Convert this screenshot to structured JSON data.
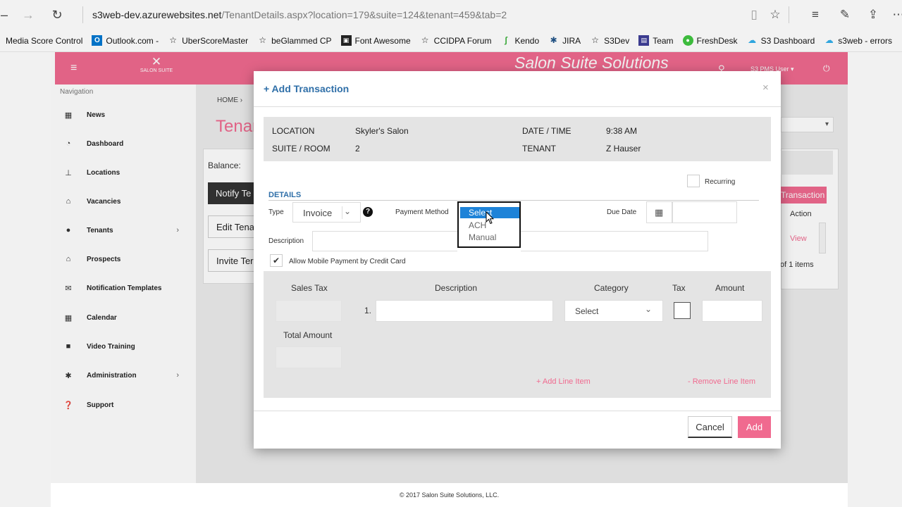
{
  "browser": {
    "url_host": "s3web-dev.azurewebsites.net",
    "url_path": "/TenantDetails.aspx?location=179&suite=124&tenant=459&tab=2",
    "favorites": [
      {
        "label": "Media Score Control",
        "icon": ""
      },
      {
        "label": "Outlook.com -",
        "icon": "outlook-icon"
      },
      {
        "label": "UberScoreMaster",
        "icon": "star-icon"
      },
      {
        "label": "beGlammed CP",
        "icon": "star-icon"
      },
      {
        "label": "Font Awesome",
        "icon": "flag-icon"
      },
      {
        "label": "CCIDPA Forum",
        "icon": "star-icon"
      },
      {
        "label": "Kendo",
        "icon": "kendo-icon"
      },
      {
        "label": "JIRA",
        "icon": "jira-icon"
      },
      {
        "label": "S3Dev",
        "icon": "star-icon"
      },
      {
        "label": "Team",
        "icon": "team-icon"
      },
      {
        "label": "FreshDesk",
        "icon": "freshdesk-icon"
      },
      {
        "label": "S3 Dashboard",
        "icon": "cloud-icon"
      },
      {
        "label": "s3web - errors",
        "icon": "cloud-icon"
      }
    ]
  },
  "app": {
    "brand_title": "Salon Suite Solutions",
    "logo_text": "SALON SUITE",
    "user_menu": "S3 PMS User",
    "nav_label": "Navigation",
    "nav_items": [
      {
        "label": "News",
        "icon": "newspaper-icon"
      },
      {
        "label": "Dashboard",
        "icon": "dashboard-icon"
      },
      {
        "label": "Locations",
        "icon": "pin-icon"
      },
      {
        "label": "Vacancies",
        "icon": "lock-icon"
      },
      {
        "label": "Tenants",
        "icon": "user-icon",
        "has_children": true
      },
      {
        "label": "Prospects",
        "icon": "lock-icon"
      },
      {
        "label": "Notification Templates",
        "icon": "envelope-icon"
      },
      {
        "label": "Calendar",
        "icon": "calendar-icon"
      },
      {
        "label": "Video Training",
        "icon": "video-icon"
      },
      {
        "label": "Administration",
        "icon": "gear-icon",
        "has_children": true
      },
      {
        "label": "Support",
        "icon": "question-icon"
      }
    ],
    "breadcrumb_home": "HOME",
    "page_title_partial": "Tenan",
    "balance_label": "Balance:",
    "bg_buttons": [
      "Notify Te",
      "Edit Tena",
      "Invite Ter"
    ],
    "bg_add_transaction": "Transaction",
    "bg_action_header": "Action",
    "bg_view_link": "View",
    "bg_items_text": "of 1 items",
    "footer": "© 2017 Salon Suite Solutions, LLC."
  },
  "modal": {
    "title": "+ Add Transaction",
    "info": {
      "location_label": "LOCATION",
      "location_value": "Skyler's Salon",
      "suite_label": "SUITE / ROOM",
      "suite_value": "2",
      "datetime_label": "DATE / TIME",
      "datetime_value": "9:38 AM",
      "tenant_label": "TENANT",
      "tenant_value": "Z Hauser"
    },
    "recurring_label": "Recurring",
    "details_label": "DETAILS",
    "type_label": "Type",
    "type_value": "Invoice",
    "payment_method_label": "Payment Method",
    "payment_options": [
      "Select",
      "ACH",
      "Manual"
    ],
    "payment_selected": "Select",
    "due_date_label": "Due Date",
    "description_label": "Description",
    "allow_mobile_label": "Allow Mobile Payment by Credit Card",
    "allow_mobile_checked": true,
    "line_items": {
      "sales_tax_header": "Sales Tax",
      "description_header": "Description",
      "category_header": "Category",
      "tax_header": "Tax",
      "amount_header": "Amount",
      "row_number": "1.",
      "category_value": "Select",
      "total_amount_label": "Total Amount",
      "add_line_item": "+ Add Line Item",
      "remove_line_item": "- Remove Line Item"
    },
    "cancel_label": "Cancel",
    "add_label": "Add"
  },
  "colors": {
    "brand_pink": "#f06a8f",
    "accent_blue": "#2f6fa8",
    "dropdown_highlight": "#1e83d8"
  }
}
